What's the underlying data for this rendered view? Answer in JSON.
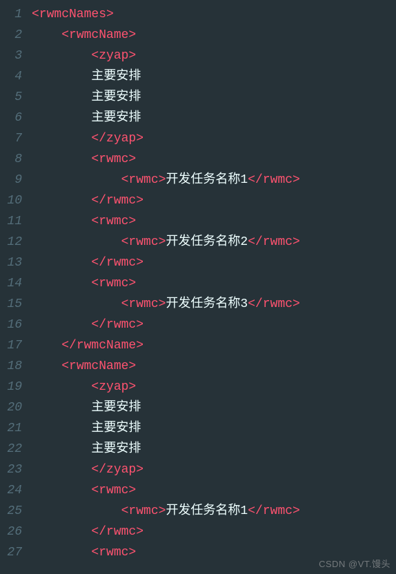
{
  "lines": [
    {
      "n": 1,
      "indent": 0,
      "segs": [
        {
          "t": "tag",
          "v": "<rwmcNames>"
        }
      ]
    },
    {
      "n": 2,
      "indent": 1,
      "segs": [
        {
          "t": "tag",
          "v": "<rwmcName>"
        }
      ]
    },
    {
      "n": 3,
      "indent": 2,
      "segs": [
        {
          "t": "tag",
          "v": "<zyap>"
        }
      ]
    },
    {
      "n": 4,
      "indent": 2,
      "segs": [
        {
          "t": "txt",
          "v": "主要安排"
        }
      ]
    },
    {
      "n": 5,
      "indent": 2,
      "segs": [
        {
          "t": "txt",
          "v": "主要安排"
        }
      ]
    },
    {
      "n": 6,
      "indent": 2,
      "segs": [
        {
          "t": "txt",
          "v": "主要安排"
        }
      ]
    },
    {
      "n": 7,
      "indent": 2,
      "segs": [
        {
          "t": "tag",
          "v": "</zyap>"
        }
      ]
    },
    {
      "n": 8,
      "indent": 2,
      "segs": [
        {
          "t": "tag",
          "v": "<rwmc>"
        }
      ]
    },
    {
      "n": 9,
      "indent": 3,
      "segs": [
        {
          "t": "tag",
          "v": "<rwmc>"
        },
        {
          "t": "txt",
          "v": "开发任务名称1"
        },
        {
          "t": "tag",
          "v": "</rwmc>"
        }
      ]
    },
    {
      "n": 10,
      "indent": 2,
      "segs": [
        {
          "t": "tag",
          "v": "</rwmc>"
        }
      ]
    },
    {
      "n": 11,
      "indent": 2,
      "segs": [
        {
          "t": "tag",
          "v": "<rwmc>"
        }
      ]
    },
    {
      "n": 12,
      "indent": 3,
      "segs": [
        {
          "t": "tag",
          "v": "<rwmc>"
        },
        {
          "t": "txt",
          "v": "开发任务名称2"
        },
        {
          "t": "tag",
          "v": "</rwmc>"
        }
      ]
    },
    {
      "n": 13,
      "indent": 2,
      "segs": [
        {
          "t": "tag",
          "v": "</rwmc>"
        }
      ]
    },
    {
      "n": 14,
      "indent": 2,
      "segs": [
        {
          "t": "tag",
          "v": "<rwmc>"
        }
      ]
    },
    {
      "n": 15,
      "indent": 3,
      "segs": [
        {
          "t": "tag",
          "v": "<rwmc>"
        },
        {
          "t": "txt",
          "v": "开发任务名称3"
        },
        {
          "t": "tag",
          "v": "</rwmc>"
        }
      ]
    },
    {
      "n": 16,
      "indent": 2,
      "segs": [
        {
          "t": "tag",
          "v": "</rwmc>"
        }
      ]
    },
    {
      "n": 17,
      "indent": 1,
      "segs": [
        {
          "t": "tag",
          "v": "</rwmcName>"
        }
      ]
    },
    {
      "n": 18,
      "indent": 1,
      "segs": [
        {
          "t": "tag",
          "v": "<rwmcName>"
        }
      ]
    },
    {
      "n": 19,
      "indent": 2,
      "segs": [
        {
          "t": "tag",
          "v": "<zyap>"
        }
      ]
    },
    {
      "n": 20,
      "indent": 2,
      "segs": [
        {
          "t": "txt",
          "v": "主要安排"
        }
      ]
    },
    {
      "n": 21,
      "indent": 2,
      "segs": [
        {
          "t": "txt",
          "v": "主要安排"
        }
      ]
    },
    {
      "n": 22,
      "indent": 2,
      "segs": [
        {
          "t": "txt",
          "v": "主要安排"
        }
      ]
    },
    {
      "n": 23,
      "indent": 2,
      "segs": [
        {
          "t": "tag",
          "v": "</zyap>"
        }
      ]
    },
    {
      "n": 24,
      "indent": 2,
      "segs": [
        {
          "t": "tag",
          "v": "<rwmc>"
        }
      ]
    },
    {
      "n": 25,
      "indent": 3,
      "segs": [
        {
          "t": "tag",
          "v": "<rwmc>"
        },
        {
          "t": "txt",
          "v": "开发任务名称1"
        },
        {
          "t": "tag",
          "v": "</rwmc>"
        }
      ]
    },
    {
      "n": 26,
      "indent": 2,
      "segs": [
        {
          "t": "tag",
          "v": "</rwmc>"
        }
      ]
    },
    {
      "n": 27,
      "indent": 2,
      "segs": [
        {
          "t": "tag",
          "v": "<rwmc>"
        }
      ]
    }
  ],
  "indent_unit": "    ",
  "watermark": "CSDN @VT.馒头"
}
